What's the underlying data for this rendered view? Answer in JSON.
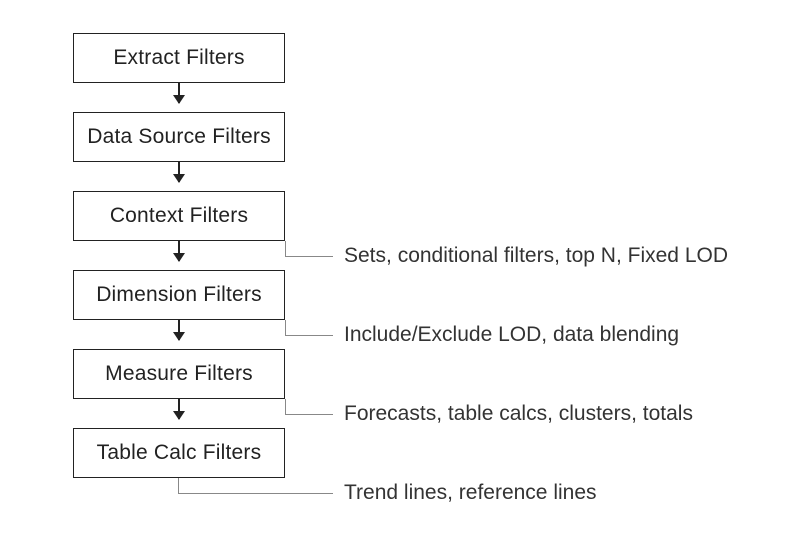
{
  "boxes": {
    "b0": "Extract Filters",
    "b1": "Data Source Filters",
    "b2": "Context Filters",
    "b3": "Dimension Filters",
    "b4": "Measure Filters",
    "b5": "Table Calc Filters"
  },
  "labels": {
    "l0": "Sets, conditional filters, top N, Fixed LOD",
    "l1": "Include/Exclude LOD, data blending",
    "l2": "Forecasts, table calcs, clusters, totals",
    "l3": "Trend lines, reference lines"
  }
}
